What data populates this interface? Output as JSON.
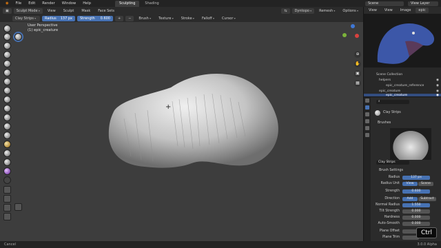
{
  "menu": [
    "File",
    "Edit",
    "Render",
    "Window",
    "Help"
  ],
  "workspace_tabs": [
    "Sculpting",
    "Shading"
  ],
  "scene_label": "Scene",
  "view_layer_label": "View Layer",
  "header": {
    "mode": "Sculpt Mode",
    "menus": [
      "View",
      "Sculpt",
      "Mask",
      "Face Sets"
    ],
    "dyntopo": "Dyntopo",
    "remesh": "Remesh",
    "options": "Options"
  },
  "tool_header": {
    "brush": "Clay Strips",
    "radius_label": "Radius",
    "radius_value": "137 px",
    "strength_label": "Strength",
    "strength_value": "0.600",
    "menus": [
      "Brush",
      "Texture",
      "Stroke",
      "Falloff",
      "Cursor"
    ]
  },
  "viewport": {
    "perspective": "User Perspective",
    "object": "(1) epic_creature"
  },
  "outliner": {
    "header_menus": [
      "View",
      "View",
      "Image"
    ],
    "image_tab": "epic",
    "items": [
      {
        "label": "Scene Collection",
        "selected": false
      },
      {
        "label": "helpers",
        "selected": false
      },
      {
        "label": "epic_creature_reference",
        "selected": false
      },
      {
        "label": "epic_creature",
        "selected": false
      },
      {
        "label": "epic_creature",
        "selected": true
      }
    ]
  },
  "properties": {
    "brush_name": "Clay Strips",
    "brushes_section": "Brushes",
    "brush_field": "Clay Strips",
    "settings_section": "Brush Settings",
    "rows": [
      {
        "label": "Radius",
        "value": "137 px"
      },
      {
        "label": "Radius Unit",
        "value": "View",
        "value2": "Scene"
      },
      {
        "label": "Strength",
        "value": "0.600"
      },
      {
        "label": "Direction",
        "value": "Add",
        "value2": "Subtract"
      },
      {
        "label": "Normal Radius",
        "value": "1.550"
      },
      {
        "label": "Tilt Strength",
        "value": "0.000"
      },
      {
        "label": "Hardness",
        "value": "0.000"
      },
      {
        "label": "Auto-Smooth",
        "value": "0.000"
      },
      {
        "label": "Plane Offset",
        "value": ""
      },
      {
        "label": "Plane Trim",
        "value": ""
      }
    ]
  },
  "status": {
    "left": "Cancel",
    "right": "3.0.0 Alpha"
  },
  "key_badge": "Ctrl"
}
